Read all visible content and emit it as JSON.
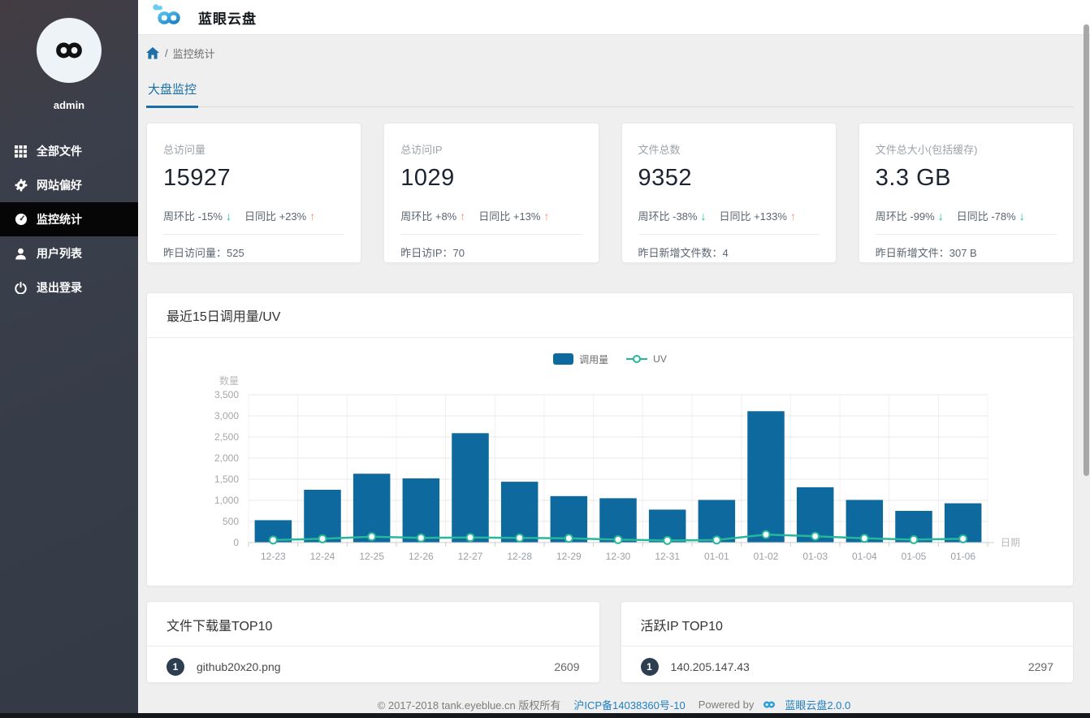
{
  "header": {
    "app_title": "蓝眼云盘"
  },
  "sidebar": {
    "username": "admin",
    "items": [
      {
        "label": "全部文件",
        "icon": "grid-icon",
        "active": false
      },
      {
        "label": "网站偏好",
        "icon": "gear-icon",
        "active": false
      },
      {
        "label": "监控统计",
        "icon": "dashboard-icon",
        "active": true
      },
      {
        "label": "用户列表",
        "icon": "user-icon",
        "active": false
      },
      {
        "label": "退出登录",
        "icon": "power-icon",
        "active": false
      }
    ]
  },
  "breadcrumb": {
    "separator": "/",
    "current": "监控统计"
  },
  "tabs": [
    {
      "label": "大盘监控",
      "active": true
    }
  ],
  "stat_cards": [
    {
      "label": "总访问量",
      "value": "15927",
      "week_text": "周环比 -15%",
      "week_dir": "down",
      "day_text": "日同比 +23%",
      "day_dir": "up",
      "bottom_text": "昨日访问量：525"
    },
    {
      "label": "总访问IP",
      "value": "1029",
      "week_text": "周环比 +8%",
      "week_dir": "up",
      "day_text": "日同比 +13%",
      "day_dir": "up",
      "bottom_text": "昨日访IP：70"
    },
    {
      "label": "文件总数",
      "value": "9352",
      "week_text": "周环比 -38%",
      "week_dir": "down",
      "day_text": "日同比 +133%",
      "day_dir": "up",
      "bottom_text": "昨日新增文件数：4"
    },
    {
      "label": "文件总大小(包括缓存)",
      "value": "3.3 GB",
      "week_text": "周环比 -99%",
      "week_dir": "down",
      "day_text": "日同比 -78%",
      "day_dir": "down",
      "bottom_text": "昨日新增文件：307 B"
    }
  ],
  "chart_card": {
    "title": "最近15日调用量/UV"
  },
  "chart_data": {
    "type": "bar+line",
    "title": "最近15日调用量/UV",
    "categories": [
      "12-23",
      "12-24",
      "12-25",
      "12-26",
      "12-27",
      "12-28",
      "12-29",
      "12-30",
      "12-31",
      "01-01",
      "01-02",
      "01-03",
      "01-04",
      "01-05",
      "01-06"
    ],
    "series": [
      {
        "name": "调用量",
        "type": "bar",
        "color": "#0e699e",
        "values": [
          530,
          1250,
          1630,
          1520,
          2590,
          1440,
          1100,
          1050,
          780,
          1010,
          3110,
          1310,
          1010,
          750,
          930
        ]
      },
      {
        "name": "UV",
        "type": "line",
        "color": "#27b79a",
        "values": [
          60,
          90,
          140,
          110,
          120,
          110,
          100,
          70,
          50,
          60,
          190,
          150,
          100,
          70,
          90
        ]
      }
    ],
    "xlabel": "日期",
    "ylabel": "数量",
    "ylim": [
      0,
      3500
    ],
    "ytick_step": 500,
    "grid": true,
    "legend_position": "top-center"
  },
  "top_files": {
    "title": "文件下载量TOP10",
    "rows": [
      {
        "rank": "1",
        "name": "github20x20.png",
        "count": "2609"
      }
    ]
  },
  "top_ips": {
    "title": "活跃IP TOP10",
    "rows": [
      {
        "rank": "1",
        "name": "140.205.147.43",
        "count": "2297"
      }
    ]
  },
  "footer": {
    "copyright": "© 2017-2018 tank.eyeblue.cn 版权所有",
    "icp": "沪ICP备14038360号-10",
    "powered_by": "Powered by",
    "product": "蓝眼云盘2.0.0"
  },
  "colors": {
    "accent_blue": "#176fa5",
    "link_blue": "#1f7fc0",
    "bar_blue": "#0e699e",
    "line_teal": "#27b79a",
    "up_orange": "#f98e6d",
    "down_green": "#19bc9c",
    "sidebar_bg": "#363c48",
    "active_item_bg": "#060606",
    "rank_badge": "#2d3e50"
  }
}
